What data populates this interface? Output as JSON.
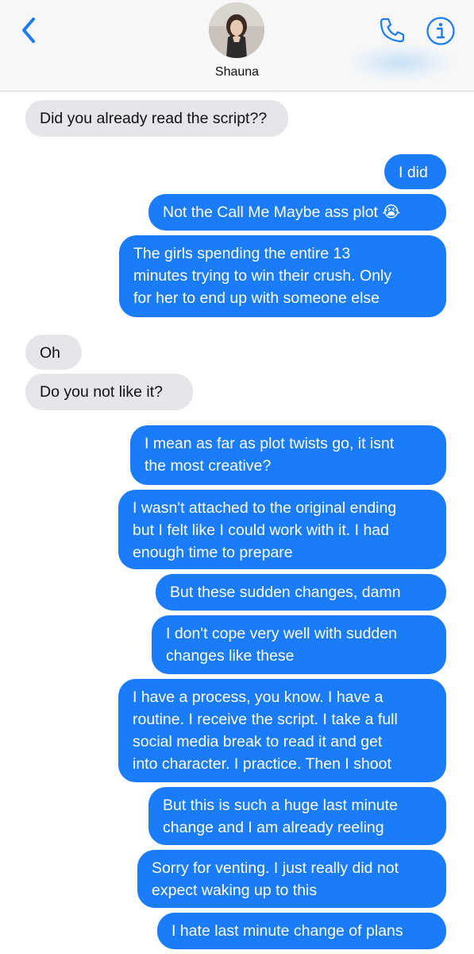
{
  "header": {
    "contact_name": "Shauna"
  },
  "icons": {
    "back": "chevron-left",
    "call": "phone",
    "info": "info-circle"
  },
  "colors": {
    "accent": "#1a7cf8",
    "incoming_bubble": "#e5e5ea",
    "outgoing_bubble": "#1a7cf8",
    "header_bg": "#f7f7f7"
  },
  "messages": [
    {
      "direction": "incoming",
      "text": "Did you already read the script??"
    },
    {
      "direction": "outgoing",
      "text": "I did"
    },
    {
      "direction": "outgoing",
      "text": "Not the Call Me Maybe ass plot 😭"
    },
    {
      "direction": "outgoing",
      "text": "The girls spending the entire 13\nminutes trying to win their crush. Only\nfor her to end up with someone else"
    },
    {
      "direction": "incoming",
      "text": "Oh"
    },
    {
      "direction": "incoming",
      "text": "Do you not like it?"
    },
    {
      "direction": "outgoing",
      "text": "I mean  as far as plot twists go, it isnt\nthe most creative?"
    },
    {
      "direction": "outgoing",
      "text": "I wasn't attached to the original ending\nbut I felt like I could work with it. I had\nenough time to prepare"
    },
    {
      "direction": "outgoing",
      "text": "But these sudden changes, damn"
    },
    {
      "direction": "outgoing",
      "text": "I don't cope very well with sudden\nchanges like these"
    },
    {
      "direction": "outgoing",
      "text": "I have a process, you know. I have a\nroutine. I receive the script. I take a full\nsocial media break to read it and get\ninto character. I practice. Then I shoot"
    },
    {
      "direction": "outgoing",
      "text": "But this is such a huge last minute\nchange and I am already reeling"
    },
    {
      "direction": "outgoing",
      "text": "Sorry for venting. I just really did not\nexpect waking up to this"
    },
    {
      "direction": "outgoing",
      "text": "I hate last minute change of plans"
    }
  ]
}
